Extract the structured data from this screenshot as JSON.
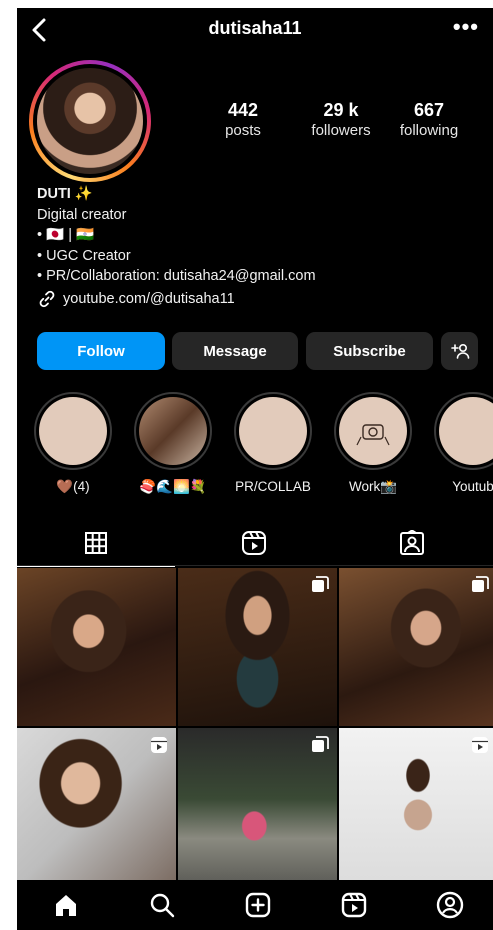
{
  "header": {
    "username": "dutisaha11",
    "back_icon": "chevron-left-icon",
    "more_label": "•••"
  },
  "profile": {
    "avatar_ring_colors": [
      "#feda75",
      "#fa7e1e",
      "#d62976",
      "#962fbf"
    ],
    "stats": {
      "posts": {
        "value": "442",
        "label": "posts"
      },
      "followers": {
        "value": "29 k",
        "label": "followers"
      },
      "following": {
        "value": "667",
        "label": "following"
      }
    }
  },
  "bio": {
    "name": "DUTI ✨",
    "category": "Digital creator",
    "line1": "• 🇯🇵 | 🇮🇳",
    "line2": "• UGC Creator",
    "line3": "• PR/Collaboration: dutisaha24@gmail.com",
    "link": "youtube.com/@dutisaha11"
  },
  "actions": {
    "follow": "Follow",
    "message": "Message",
    "subscribe": "Subscribe",
    "add_user_icon": "add-user-icon",
    "accent": "#0095f6"
  },
  "highlights": [
    {
      "label": "🤎(4)"
    },
    {
      "label": "🍣🌊🌅💐"
    },
    {
      "label": "PR/COLLAB"
    },
    {
      "label": "Work📸"
    },
    {
      "label": "Youtub"
    }
  ],
  "tabs": [
    {
      "icon": "grid-icon",
      "active": true
    },
    {
      "icon": "reels-icon",
      "active": false
    },
    {
      "icon": "tagged-icon",
      "active": false
    }
  ],
  "posts": [
    {
      "badge": ""
    },
    {
      "badge": "carousel-icon"
    },
    {
      "badge": "carousel-icon"
    },
    {
      "badge": "reels-icon"
    },
    {
      "badge": "carousel-icon"
    },
    {
      "badge": "reels-icon"
    }
  ],
  "bottom_nav": [
    "home-icon",
    "search-icon",
    "create-icon",
    "reels-icon",
    "profile-icon"
  ]
}
